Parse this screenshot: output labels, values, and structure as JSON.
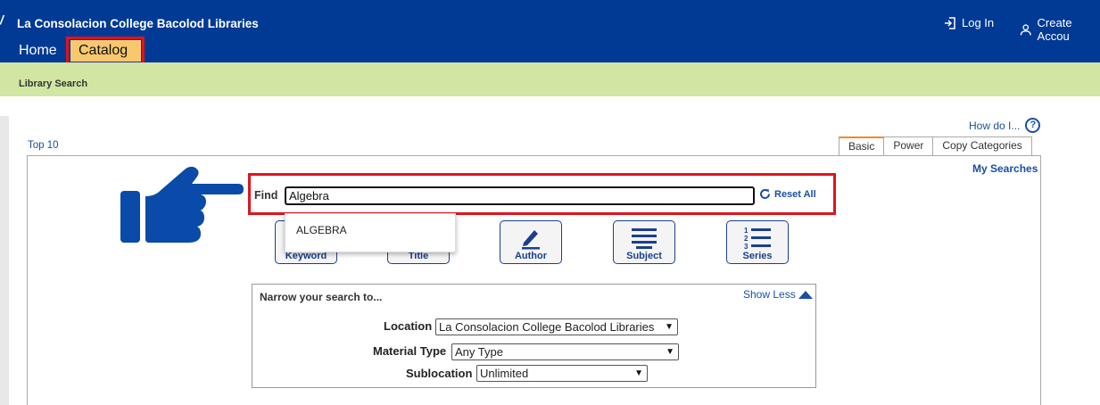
{
  "header": {
    "brand_mark": "/",
    "title": "La Consolacion College Bacolod Libraries",
    "login": "Log In",
    "create_account": "Create Accou"
  },
  "nav": {
    "home": "Home",
    "catalog": "Catalog"
  },
  "breadcrumb": "Library Search",
  "howdo": "How do I...",
  "help_glyph": "?",
  "top10": "Top 10",
  "tabs": [
    "Basic",
    "Power",
    "Copy Categories"
  ],
  "my_searches": "My Searches",
  "search": {
    "label": "Find",
    "value": "Algebra",
    "reset": "Reset All"
  },
  "suggestion": "ALGEBRA",
  "search_buttons": [
    {
      "label": "Keyword",
      "icon": "keyword-icon"
    },
    {
      "label": "Title",
      "icon": "title-icon"
    },
    {
      "label": "Author",
      "icon": "pencil-icon"
    },
    {
      "label": "Subject",
      "icon": "subject-lines-icon"
    },
    {
      "label": "Series",
      "icon": "numbered-list-icon"
    }
  ],
  "narrow": {
    "title": "Narrow your search to...",
    "show_less": "Show Less",
    "location_label": "Location",
    "location_value": "La Consolacion College Bacolod Libraries",
    "material_label": "Material Type",
    "material_value": "Any Type",
    "sublocation_label": "Sublocation",
    "sublocation_value": "Unlimited"
  },
  "colors": {
    "header": "#003a94",
    "subbar": "#d1e6a2",
    "highlight": "#e0131c",
    "catalog_tab": "#f7c86e",
    "link": "#1a4fa3"
  }
}
